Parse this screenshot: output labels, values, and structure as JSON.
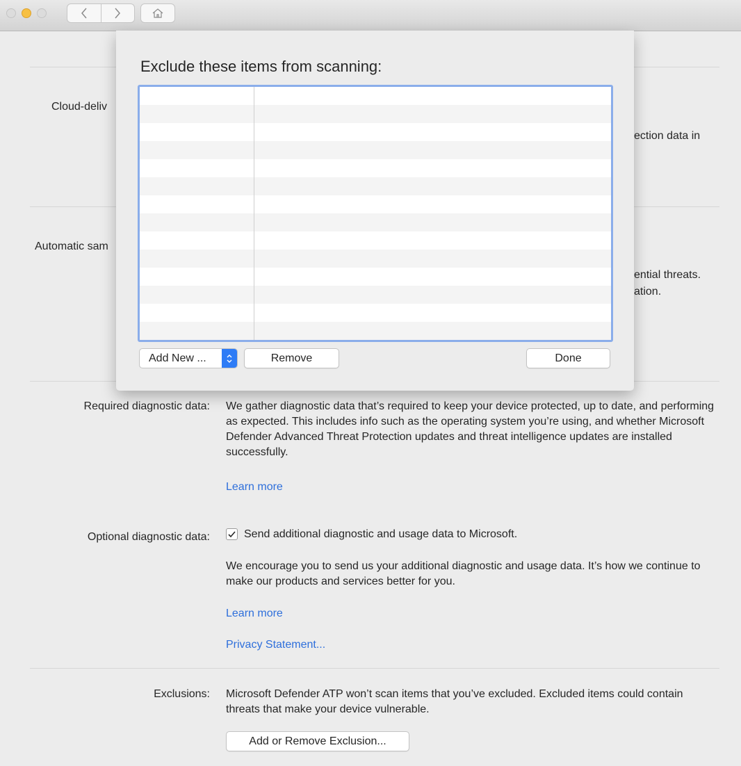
{
  "window": {
    "nav": {
      "back_icon": "chevron-left-icon",
      "forward_icon": "chevron-right-icon",
      "home_icon": "home-icon"
    }
  },
  "sections": {
    "cloud": {
      "label_partial": "Cloud-deliv",
      "text_partial": "ection data in"
    },
    "automatic": {
      "label_partial": "Automatic sam",
      "text_partial_1": "ential threats.",
      "text_partial_2": "ation."
    },
    "required": {
      "label": "Required diagnostic data:",
      "text": "We gather diagnostic data that’s required to keep your device protected, up to date, and performing as expected. This includes info such as the operating system you’re using, and whether Microsoft Defender Advanced Threat Protection updates and threat intelligence updates are installed successfully.",
      "link": "Learn more"
    },
    "optional": {
      "label": "Optional diagnostic data:",
      "checkbox_label": "Send additional diagnostic and usage data to Microsoft.",
      "checked": true,
      "text": "We encourage you to send us your additional diagnostic and usage data. It’s how we continue to make our products and services better for you.",
      "link1": "Learn more",
      "link2": "Privacy Statement..."
    },
    "exclusions": {
      "label": "Exclusions:",
      "text": "Microsoft Defender ATP won’t scan items that you’ve excluded.  Excluded items could contain threats that make your device vulnerable.",
      "button": "Add or Remove Exclusion..."
    }
  },
  "sheet": {
    "title": "Exclude these items from scanning:",
    "rows": [],
    "add_new": "Add New ...",
    "remove": "Remove",
    "done": "Done"
  },
  "colors": {
    "accent": "#2e7cf6",
    "link": "#2e6fdb",
    "table_focus": "#8aadea"
  }
}
